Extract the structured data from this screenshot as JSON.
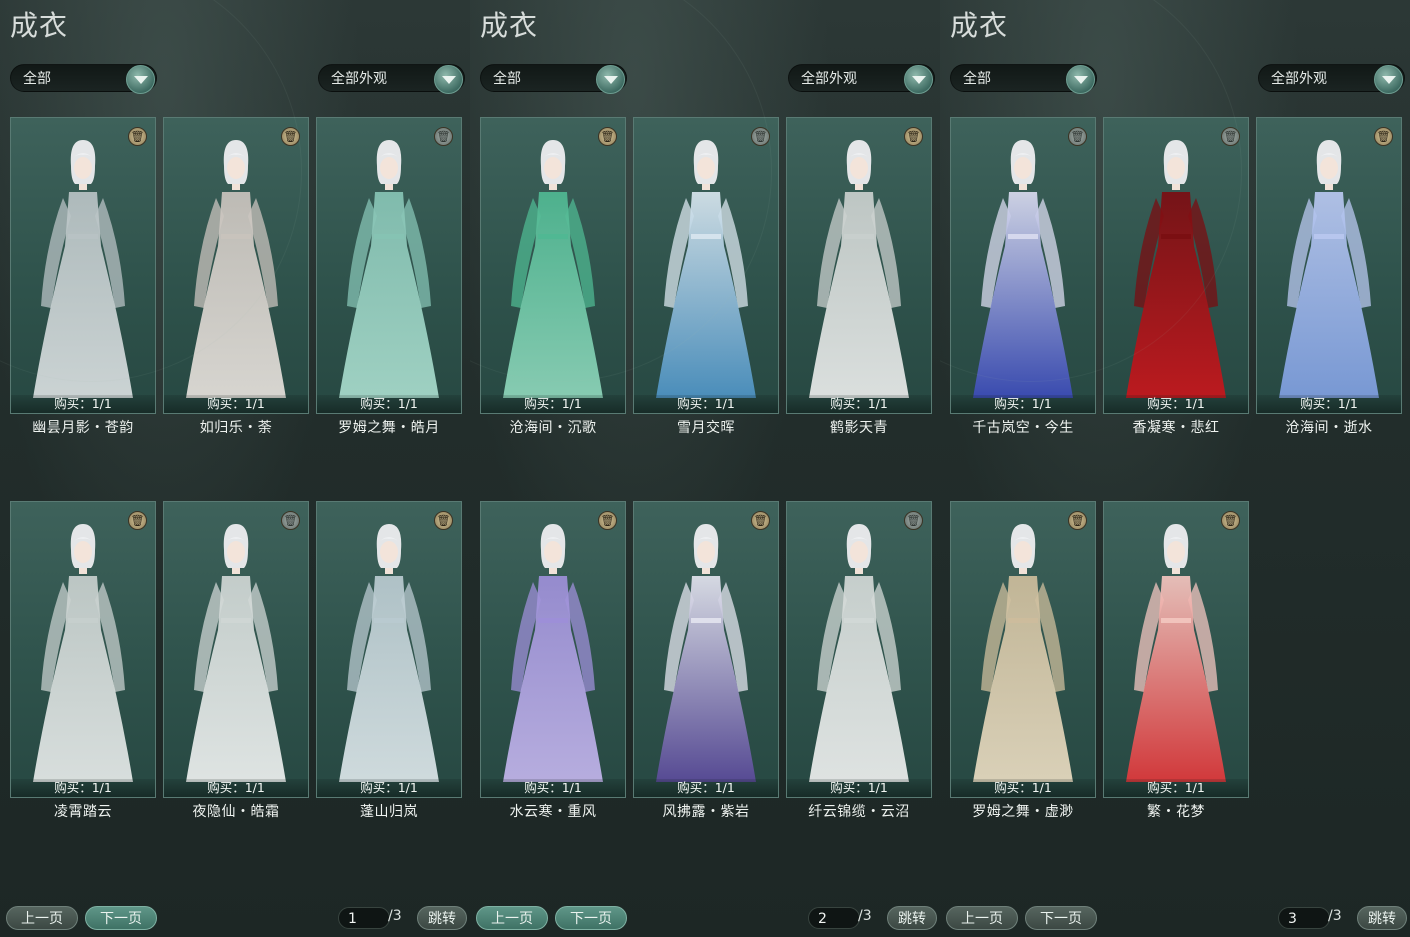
{
  "panels": [
    {
      "title": "成衣",
      "filter1": "全部",
      "filter2": "全部外观",
      "page": "1",
      "total": "/3",
      "prev_label": "上一页",
      "next_label": "下一页",
      "jump_label": "跳转",
      "items": [
        {
          "name": "幽昙月影・苍韵",
          "bought": "购买：1/1",
          "color": "#d9dfe0",
          "color2": "#b8c2c4",
          "deletable": true
        },
        {
          "name": "如归乐・荼",
          "bought": "购买：1/1",
          "color": "#e6e1dc",
          "color2": "#c9c3bd",
          "deletable": true
        },
        {
          "name": "罗姆之舞・皓月",
          "bought": "购买：1/1",
          "color": "#a9dccd",
          "color2": "#86c3b4",
          "deletable": false
        },
        {
          "name": "凌霄踏云",
          "bought": "购买：1/1",
          "color": "#e7ebea",
          "color2": "#c7cfcd",
          "deletable": true
        },
        {
          "name": "夜隐仙・皓霜",
          "bought": "购买：1/1",
          "color": "#eef1f0",
          "color2": "#cfd6d4",
          "deletable": false
        },
        {
          "name": "蓬山归岚",
          "bought": "购买：1/1",
          "color": "#dde7ea",
          "color2": "#b9cad0",
          "deletable": true
        }
      ]
    },
    {
      "title": "成衣",
      "filter1": "全部",
      "filter2": "全部外观",
      "page": "2",
      "total": "/3",
      "prev_label": "上一页",
      "next_label": "下一页",
      "jump_label": "跳转",
      "items": [
        {
          "name": "沧海间・沉歌",
          "bought": "购买：1/1",
          "color": "#8fd6bb",
          "color2": "#4fb892",
          "deletable": true
        },
        {
          "name": "雪月交晖",
          "bought": "购买：1/1",
          "color": "#4d93c4",
          "color2": "#d9e6ee",
          "deletable": false
        },
        {
          "name": "鹤影天青",
          "bought": "购买：1/1",
          "color": "#eaeceb",
          "color2": "#c9cfcd",
          "deletable": true
        },
        {
          "name": "水云寒・重风",
          "bought": "购买：1/1",
          "color": "#c3b6ec",
          "color2": "#9d8fd8",
          "deletable": true
        },
        {
          "name": "风拂露・紫岩",
          "bought": "购买：1/1",
          "color": "#5a4a9a",
          "color2": "#e3e4ee",
          "deletable": true
        },
        {
          "name": "纤云锦缆・云沼",
          "bought": "购买：1/1",
          "color": "#eef0ef",
          "color2": "#d2d8d6",
          "deletable": false
        }
      ]
    },
    {
      "title": "成衣",
      "filter1": "全部",
      "filter2": "全部外观",
      "page": "3",
      "total": "/3",
      "prev_label": "上一页",
      "next_label": "下一页",
      "jump_label": "跳转",
      "items": [
        {
          "name": "千古岚空・今生",
          "bought": "购买：1/1",
          "color": "#3b4bb8",
          "color2": "#d9dbef",
          "deletable": false
        },
        {
          "name": "香凝寒・悲红",
          "bought": "购买：1/1",
          "color": "#c8161c",
          "color2": "#7a0e12",
          "deletable": false
        },
        {
          "name": "沧海间・逝水",
          "bought": "购买：1/1",
          "color": "#7f9fe0",
          "color2": "#b9c8f0",
          "deletable": true
        },
        {
          "name": "罗姆之舞・虚渺",
          "bought": "购买：1/1",
          "color": "#e9dcc2",
          "color2": "#cdbd9c",
          "deletable": true
        },
        {
          "name": "繁・花梦",
          "bought": "购买：1/1",
          "color": "#e0373a",
          "color2": "#f3c6c0",
          "deletable": true
        }
      ]
    }
  ]
}
